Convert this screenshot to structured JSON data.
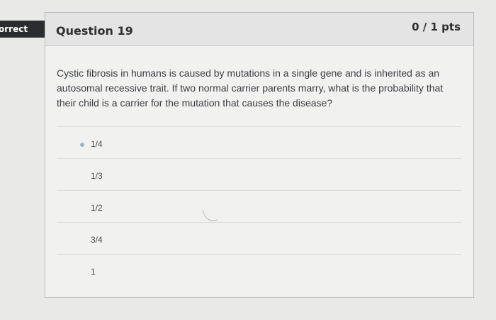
{
  "status": {
    "label": "orrect",
    "color": "#2a2c2f"
  },
  "question": {
    "title": "Question 19",
    "points": "0 / 1 pts",
    "text": "Cystic fibrosis in humans is caused by mutations in a single gene and is inherited as an autosomal recessive trait.  If two normal carrier parents marry, what is the probability that their child is a carrier for the mutation that causes the disease?"
  },
  "answers": [
    {
      "label": "1/4",
      "selected": true
    },
    {
      "label": "1/3",
      "selected": false
    },
    {
      "label": "1/2",
      "selected": false
    },
    {
      "label": "3/4",
      "selected": false
    },
    {
      "label": "1",
      "selected": false
    }
  ],
  "colors": {
    "header_bg": "#e3e4e3",
    "card_bg": "#f1f1f0",
    "flag_bg": "#2a2c2f"
  }
}
